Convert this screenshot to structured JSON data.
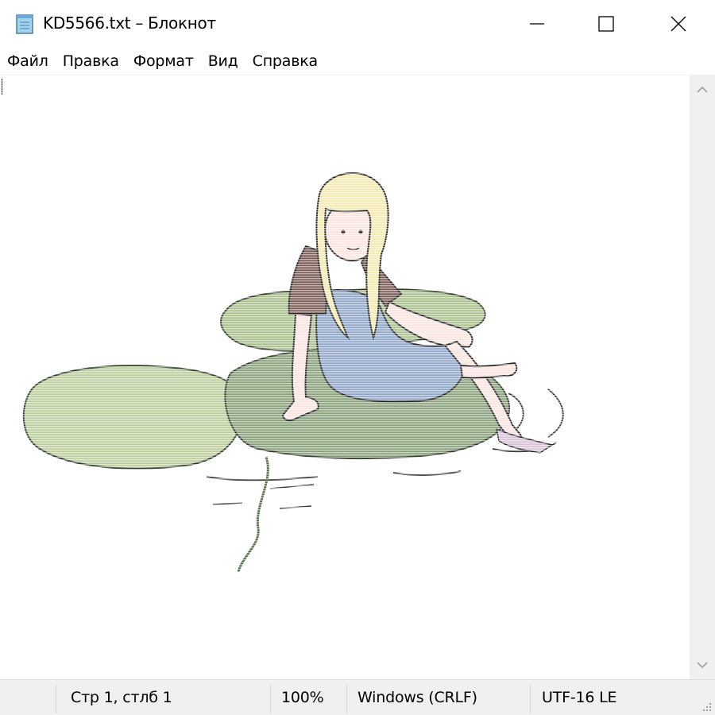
{
  "window": {
    "title": "KD5566.txt – Блокнот",
    "icon": "notepad-icon",
    "controls": [
      "minimize-icon",
      "maximize-icon",
      "close-icon"
    ]
  },
  "menu": {
    "items": [
      {
        "label": "Файл"
      },
      {
        "label": "Правка"
      },
      {
        "label": "Формат"
      },
      {
        "label": "Вид"
      },
      {
        "label": "Справка"
      }
    ]
  },
  "editor": {
    "content_type": "ascii-art illustration",
    "colors": {
      "hair": "#f4eab0",
      "overalls": "#8fa5c8",
      "shirt": "#7a5a55",
      "lilypad_light": "#a9c08c",
      "lilypad_dark": "#87a079",
      "skin": "#fbe4e0",
      "water": "#4a4a4a"
    }
  },
  "scrollbar": {
    "up_icon": "chevron-up-icon",
    "down_icon": "chevron-down-icon"
  },
  "status": {
    "position": "Стр 1, стлб 1",
    "zoom": "100%",
    "line_endings": "Windows (CRLF)",
    "encoding": "UTF-16 LE"
  }
}
